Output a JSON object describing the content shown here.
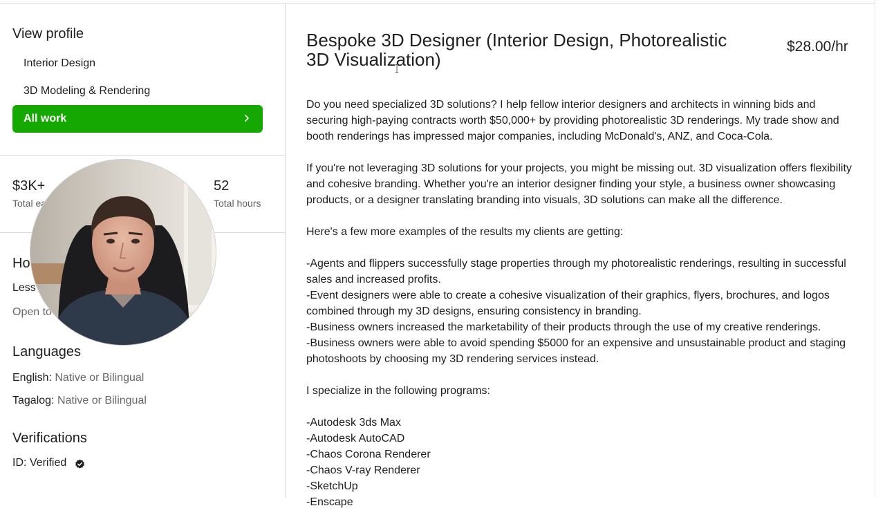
{
  "sidebar": {
    "view_profile": "View profile",
    "specialized_profiles": [
      "Interior Design",
      "3D Modeling & Rendering"
    ],
    "all_work": "All work",
    "stats": {
      "earnings_value": "$3K+",
      "earnings_label": "Total ea",
      "hours_value": "52",
      "hours_label": "Total hours"
    },
    "hours_per_week": {
      "heading": "Ho",
      "value": "Less",
      "contract": "Open to"
    },
    "languages": {
      "heading": "Languages",
      "items": [
        {
          "name": "English:",
          "level": "Native or Bilingual"
        },
        {
          "name": "Tagalog:",
          "level": "Native or Bilingual"
        }
      ]
    },
    "verifications": {
      "heading": "Verifications",
      "id_label": "ID: Verified"
    }
  },
  "main": {
    "title": "Bespoke 3D Designer (Interior Design, Photorealistic 3D Visualization)",
    "rate": "$28.00/hr",
    "description": {
      "p1": "Do you need specialized 3D solutions? I help fellow interior designers and architects in winning bids and securing high-paying contracts worth $50,000+ by providing photorealistic 3D renderings. My trade show and booth renderings has impressed major companies, including McDonald's, ANZ, and Coca-Cola.",
      "p2": "If you're not leveraging 3D solutions for your projects, you might be missing out. 3D visualization offers flexibility and cohesive branding. Whether you're an interior designer finding your style, a business owner showcasing products, or a designer translating branding into visuals, 3D solutions can make all the difference.",
      "p3": "Here's a few more examples of the results my clients are getting:",
      "results": [
        "-Agents and flippers successfully stage properties through my photorealistic renderings, resulting in successful sales and increased profits.",
        "-Event designers were able to create a cohesive visualization of their graphics, flyers, brochures, and logos combined through my 3D designs, ensuring consistency in branding.",
        "-Business owners increased the marketability of their products through the use of my creative renderings.",
        "-Business owners were able to avoid spending $5000 for an expensive and unsustainable product and staging photoshoots by choosing my 3D rendering services instead."
      ],
      "p4": "I specialize in the following programs:",
      "programs": [
        "-Autodesk 3ds Max",
        "-Autodesk AutoCAD",
        "-Chaos Corona Renderer",
        "-Chaos V-ray Renderer",
        "-SketchUp",
        "-Enscape"
      ]
    }
  },
  "colors": {
    "accent_green": "#14a800",
    "text": "#1f1f1f",
    "muted": "#676767"
  },
  "icons": [
    "chevron-right-icon",
    "verified-check-icon",
    "text-cursor-icon"
  ]
}
